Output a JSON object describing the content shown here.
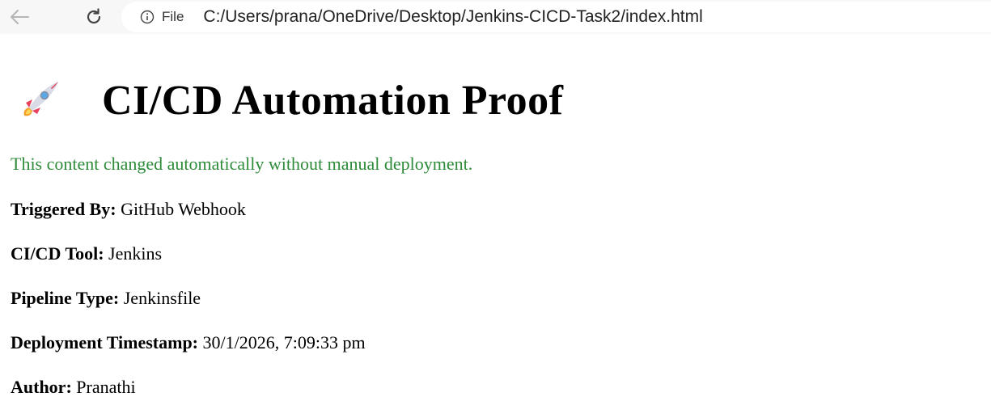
{
  "browser": {
    "scheme_label": "File",
    "url": "C:/Users/prana/OneDrive/Desktop/Jenkins-CICD-Task2/index.html",
    "icons": {
      "back": "arrow-left-icon",
      "reload": "reload-icon",
      "info": "info-icon"
    }
  },
  "page": {
    "heading_icon": "rocket-icon",
    "heading": "CI/CD Automation Proof",
    "message": "This content changed automatically without manual deployment.",
    "message_color": "#2e8b3a",
    "details": [
      {
        "label": "Triggered By:",
        "value": "GitHub Webhook"
      },
      {
        "label": "CI/CD Tool:",
        "value": "Jenkins"
      },
      {
        "label": "Pipeline Type:",
        "value": "Jenkinsfile"
      },
      {
        "label": "Deployment Timestamp:",
        "value": "30/1/2026, 7:09:33 pm"
      },
      {
        "label": "Author:",
        "value": "Pranathi"
      }
    ]
  }
}
